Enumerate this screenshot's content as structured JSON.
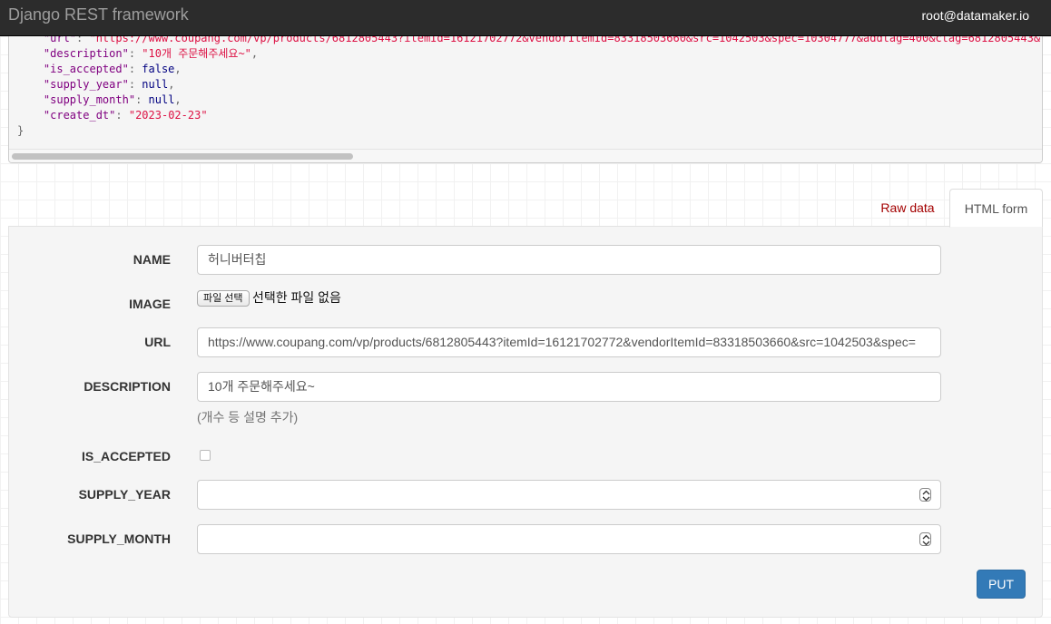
{
  "navbar": {
    "brand": "Django REST framework",
    "user": "root@datamaker.io"
  },
  "response_json": {
    "lines": [
      {
        "key": "\"url\"",
        "value": "\"https://www.coupang.com/vp/products/6812805443?itemId=16121702772&vendorItemId=83318503660&src=1042503&spec=10304777&addtag=400&ctag=6812805443&",
        "value_type": "string",
        "comma": false
      },
      {
        "key": "\"description\"",
        "value": "\"10개 주문해주세요~\"",
        "value_type": "string",
        "comma": true
      },
      {
        "key": "\"is_accepted\"",
        "value": "false",
        "value_type": "literal",
        "comma": true
      },
      {
        "key": "\"supply_year\"",
        "value": "null",
        "value_type": "literal",
        "comma": true
      },
      {
        "key": "\"supply_month\"",
        "value": "null",
        "value_type": "literal",
        "comma": true
      },
      {
        "key": "\"create_dt\"",
        "value": "\"2023-02-23\"",
        "value_type": "string",
        "comma": false
      }
    ],
    "closing_brace": "}"
  },
  "tabs": {
    "raw_data": "Raw data",
    "html_form": "HTML form"
  },
  "form": {
    "name_label": "NAME",
    "name_value": "허니버터칩",
    "image_label": "IMAGE",
    "image_button": "파일 선택",
    "image_status": "선택한 파일 없음",
    "url_label": "URL",
    "url_value": "https://www.coupang.com/vp/products/6812805443?itemId=16121702772&vendorItemId=83318503660&src=1042503&spec=",
    "description_label": "DESCRIPTION",
    "description_value": "10개 주문해주세요~",
    "description_help": "(개수 등 설명 추가)",
    "is_accepted_label": "IS_ACCEPTED",
    "is_accepted_checked": false,
    "supply_year_label": "SUPPLY_YEAR",
    "supply_year_value": "",
    "supply_month_label": "SUPPLY_MONTH",
    "supply_month_value": "",
    "submit_label": "PUT"
  },
  "colors": {
    "navbar_bg": "#2c2c2c",
    "json_key": "#800080",
    "json_string": "#dd1144",
    "json_literal": "#000080",
    "raw_data_tab": "#a30000",
    "put_button": "#337ab7"
  }
}
